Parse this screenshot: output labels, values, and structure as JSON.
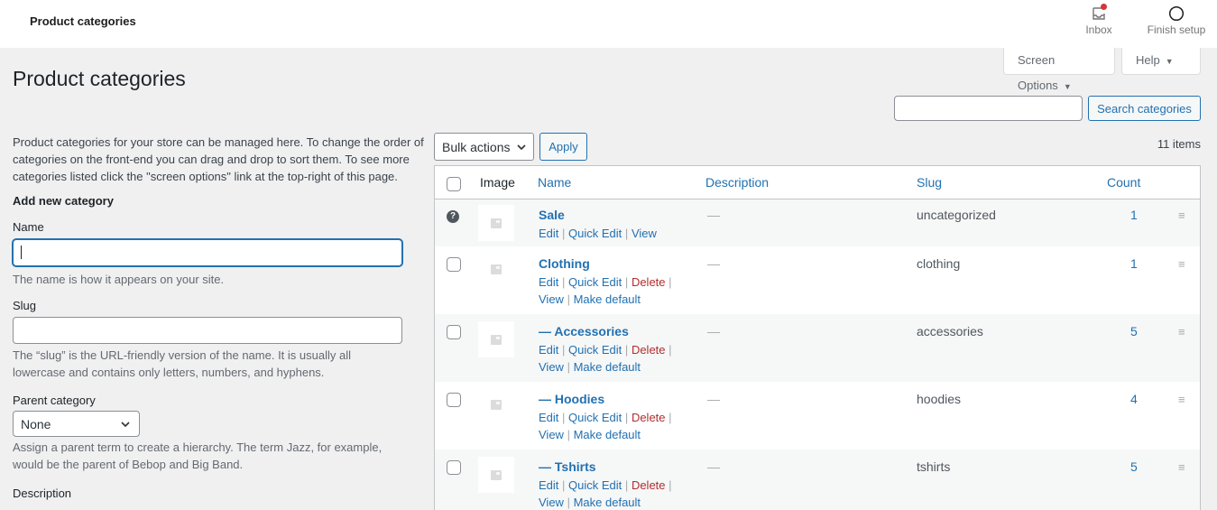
{
  "topbar": {
    "title": "Product categories",
    "inbox_label": "Inbox",
    "finish_setup_label": "Finish setup",
    "inbox_icon": "inbox-icon",
    "finish_setup_icon": "circle-progress-icon",
    "notification_color": "#d63638"
  },
  "screen_meta": {
    "screen_options_label": "Screen Options",
    "help_label": "Help"
  },
  "page": {
    "title": "Product categories"
  },
  "search": {
    "value": "",
    "placeholder": "",
    "button_label": "Search categories"
  },
  "form": {
    "intro": "Product categories for your store can be managed here. To change the order of categories on the front-end you can drag and drop to sort them. To see more categories listed click the \"screen options\" link at the top-right of this page.",
    "heading": "Add new category",
    "name_label": "Name",
    "name_value": "",
    "name_help": "The name is how it appears on your site.",
    "slug_label": "Slug",
    "slug_value": "",
    "slug_help": "The “slug” is the URL-friendly version of the name. It is usually all lowercase and contains only letters, numbers, and hyphens.",
    "parent_label": "Parent category",
    "parent_selected": "None",
    "parent_help": "Assign a parent term to create a hierarchy. The term Jazz, for example, would be the parent of Bebop and Big Band.",
    "description_label": "Description"
  },
  "tablenav": {
    "bulk_actions_label": "Bulk actions",
    "apply_label": "Apply",
    "items_count": "11 items"
  },
  "table": {
    "columns": {
      "image": "Image",
      "name": "Name",
      "description": "Description",
      "slug": "Slug",
      "count": "Count"
    },
    "action_labels": {
      "edit": "Edit",
      "quick_edit": "Quick Edit",
      "delete": "Delete",
      "view": "View",
      "make_default": "Make default",
      "separator": "|"
    },
    "rows": [
      {
        "name": "Sale",
        "description": "—",
        "slug": "uncategorized",
        "count": "1",
        "default": true
      },
      {
        "name": "Clothing",
        "description": "—",
        "slug": "clothing",
        "count": "1"
      },
      {
        "name": "— Accessories",
        "description": "—",
        "slug": "accessories",
        "count": "5"
      },
      {
        "name": "— Hoodies",
        "description": "—",
        "slug": "hoodies",
        "count": "4"
      },
      {
        "name": "— Tshirts",
        "description": "—",
        "slug": "tshirts",
        "count": "5"
      }
    ]
  },
  "colors": {
    "accent": "#2271b1",
    "delete": "#b32d2e",
    "background": "#f0f0f1"
  }
}
